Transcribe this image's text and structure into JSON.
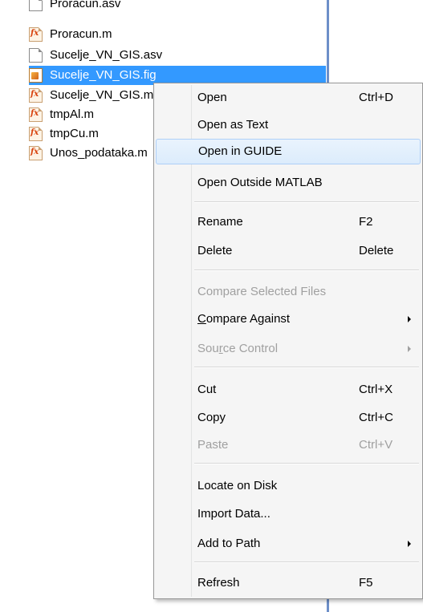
{
  "files": [
    {
      "name": "Proracun.asv",
      "type": "asv"
    },
    {
      "name": "Proracun.m",
      "type": "m"
    },
    {
      "name": "Sucelje_VN_GIS.asv",
      "type": "asv"
    },
    {
      "name": "Sucelje_VN_GIS.fig",
      "type": "fig",
      "selected": true
    },
    {
      "name": "Sucelje_VN_GIS.m",
      "type": "m"
    },
    {
      "name": "tmpAl.m",
      "type": "m"
    },
    {
      "name": "tmpCu.m",
      "type": "m"
    },
    {
      "name": "Unos_podataka.m",
      "type": "m"
    }
  ],
  "menu": {
    "open": {
      "label": "Open",
      "shortcut": "Ctrl+D"
    },
    "open_as_text": {
      "label": "Open as Text"
    },
    "open_in_guide": {
      "label": "Open in GUIDE"
    },
    "open_outside": {
      "label": "Open Outside MATLAB"
    },
    "rename": {
      "label": "Rename",
      "shortcut": "F2"
    },
    "delete": {
      "label": "Delete",
      "shortcut": "Delete"
    },
    "compare_selected": {
      "label": "Compare Selected Files"
    },
    "compare_against": {
      "label_pre": "",
      "label_u": "C",
      "label_post": "ompare Against"
    },
    "source_control": {
      "label_pre": "Sou",
      "label_u": "r",
      "label_post": "ce Control"
    },
    "cut": {
      "label": "Cut",
      "shortcut": "Ctrl+X"
    },
    "copy": {
      "label": "Copy",
      "shortcut": "Ctrl+C"
    },
    "paste": {
      "label": "Paste",
      "shortcut": "Ctrl+V"
    },
    "locate": {
      "label": "Locate on Disk"
    },
    "import": {
      "label": "Import Data..."
    },
    "add_path": {
      "label": "Add to Path"
    },
    "refresh": {
      "label": "Refresh",
      "shortcut": "F5"
    }
  },
  "colors": {
    "selection": "#3399ff",
    "panel_border": "#6d8fc9",
    "menu_bg": "#f5f5f5",
    "disabled_text": "#a0a0a0"
  }
}
